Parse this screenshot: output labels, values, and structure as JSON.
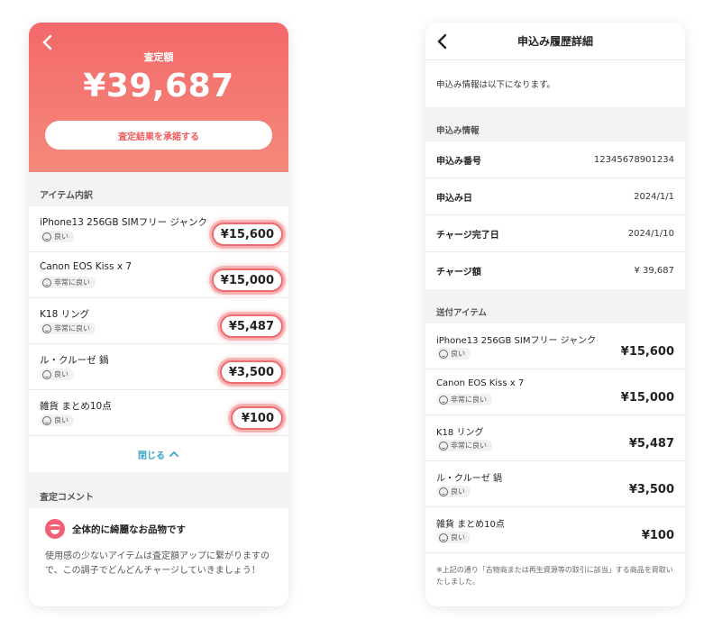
{
  "left": {
    "header": {
      "label": "査定額",
      "amount": "¥39,687",
      "accept_button": "査定結果を承諾する"
    },
    "items_section": "アイテム内訳",
    "items": [
      {
        "name": "iPhone13 256GB SIMフリー ジャンク",
        "condition": "良い",
        "price": "¥15,600"
      },
      {
        "name": "Canon EOS Kiss  x 7",
        "condition": "非常に良い",
        "price": "¥15,000"
      },
      {
        "name": "K18 リング",
        "condition": "非常に良い",
        "price": "¥5,487"
      },
      {
        "name": "ル・クルーゼ 鍋",
        "condition": "良い",
        "price": "¥3,500"
      },
      {
        "name": "雑貨 まとめ10点",
        "condition": "良い",
        "price": "¥100"
      }
    ],
    "close_label": "閉じる",
    "comment_section": "査定コメント",
    "comment_title": "全体的に綺麗なお品物です",
    "comment_body": "使用感の少ないアイテムは査定額アップに繋がりますので、この調子でどんどんチャージしていきましょう！"
  },
  "right": {
    "title": "申込み履歴詳細",
    "intro": "申込み情報は以下になります。",
    "info_section": "申込み情報",
    "info": [
      {
        "key": "申込み番号",
        "value": "12345678901234"
      },
      {
        "key": "申込み日",
        "value": "2024/1/1"
      },
      {
        "key": "チャージ完了日",
        "value": "2024/1/10"
      },
      {
        "key": "チャージ額",
        "value": "¥ 39,687"
      }
    ],
    "items_section": "送付アイテム",
    "items": [
      {
        "name": "iPhone13 256GB SIMフリー ジャンク",
        "condition": "良い",
        "price": "¥15,600"
      },
      {
        "name": "Canon EOS Kiss  x 7",
        "condition": "非常に良い",
        "price": "¥15,000"
      },
      {
        "name": "K18 リング",
        "condition": "非常に良い",
        "price": "¥5,487"
      },
      {
        "name": "ル・クルーゼ 鍋",
        "condition": "良い",
        "price": "¥3,500"
      },
      {
        "name": "雑貨 まとめ10点",
        "condition": "良い",
        "price": "¥100"
      }
    ],
    "footnote": "※上記の通り「古物商または再生資源等の取引に該当」する商品を買取いたしました。"
  },
  "colors": {
    "accent": "#f3686a",
    "link": "#3aa6c6"
  },
  "icons": {
    "back": "chevron-left-icon",
    "close": "chevron-up-icon",
    "condition": "smile-face-icon",
    "comment": "happy-face-icon"
  }
}
